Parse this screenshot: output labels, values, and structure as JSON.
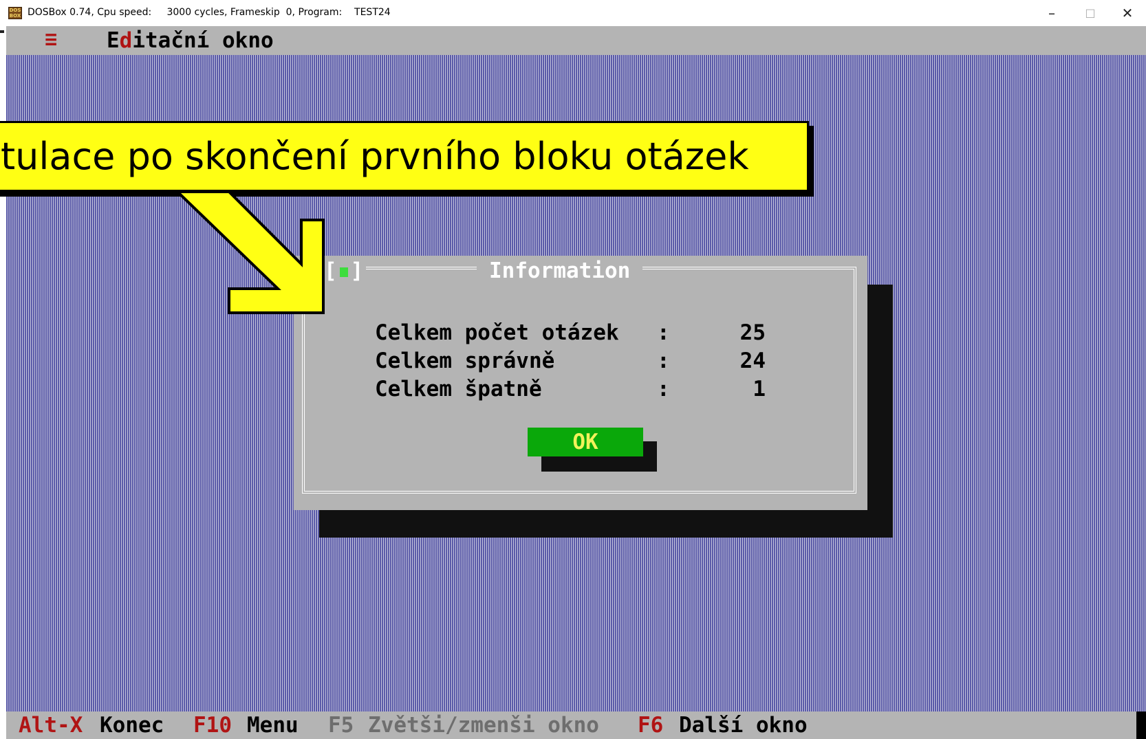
{
  "window": {
    "title_text": "DOSBox 0.74, Cpu speed:     3000 cycles, Frameskip  0, Program:    TEST24",
    "app_icon_text": "DOS BOX",
    "minimize_glyph": "–",
    "maximize_glyph": "□",
    "close_glyph": "✕"
  },
  "menubar": {
    "menu_glyph": "≡",
    "title_hot": "Ed",
    "title_hot_letter": "d",
    "title_rest": "itační okno"
  },
  "callout": {
    "text": "tulace po skončení prvního bloku otázek"
  },
  "dialog": {
    "close_box": "[",
    "close_box_end": "]",
    "title": "Information",
    "rows": [
      {
        "label": "Celkem počet otázek",
        "colon": ":",
        "value": "25"
      },
      {
        "label": "Celkem správně",
        "colon": ":",
        "value": "24"
      },
      {
        "label": "Celkem špatně",
        "colon": ":",
        "value": "1"
      }
    ],
    "ok_label": "OK"
  },
  "statusbar": {
    "items": [
      {
        "key": "Alt-X",
        "text": "Konec"
      },
      {
        "key": "F10",
        "text": "Menu"
      },
      {
        "key": "F5",
        "text": "Zvětši/zmenši okno"
      },
      {
        "key": "F6",
        "text": "Další okno"
      }
    ]
  },
  "colors": {
    "desktop": "#5a5aa8",
    "panel_gray": "#b4b4b4",
    "hotkey_red": "#b01414",
    "ok_green": "#0aa80a",
    "ok_text_yellow": "#f2f25a",
    "callout_yellow": "#ffff14"
  }
}
